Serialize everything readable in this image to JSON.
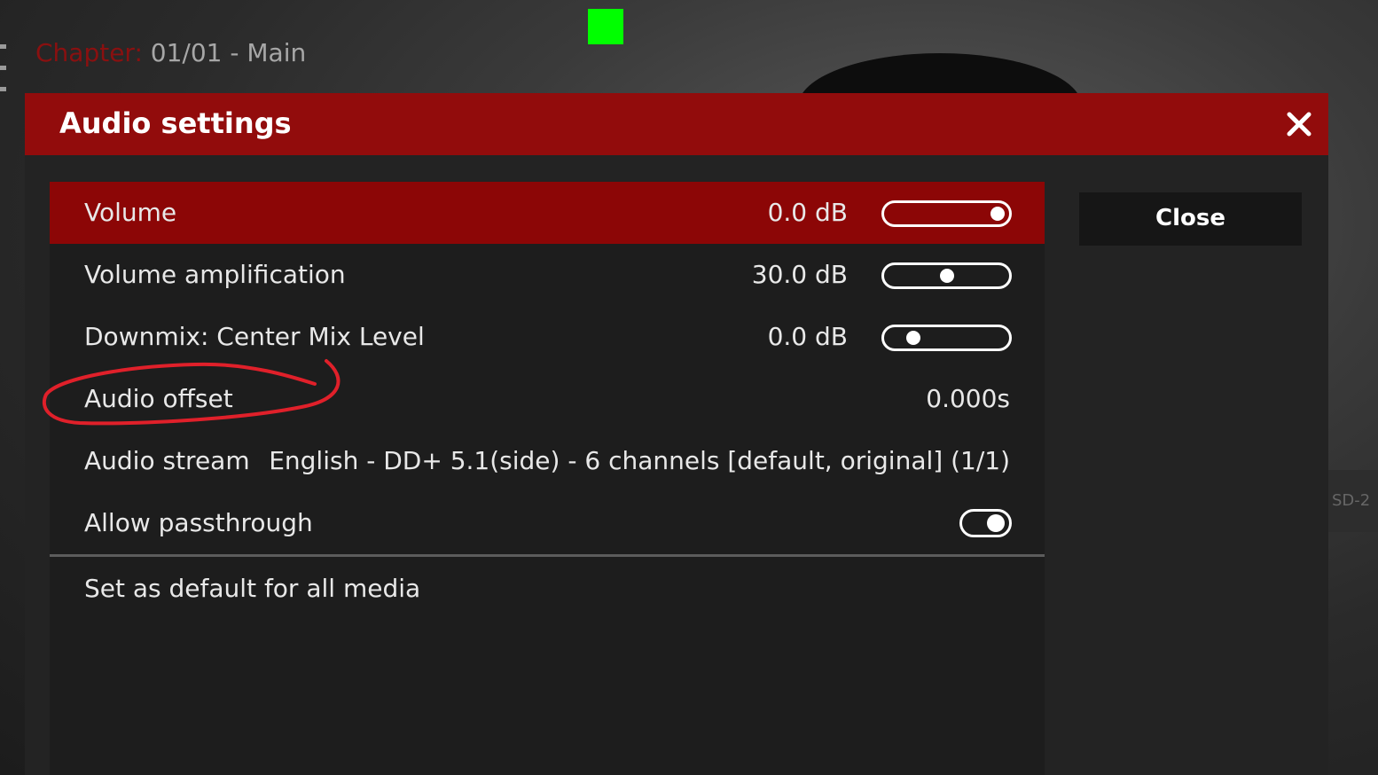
{
  "player": {
    "chapter_label": "Chapter:",
    "chapter_value": " 01/01 - Main",
    "side_panel_text": "SD-2"
  },
  "dialog": {
    "title": "Audio settings",
    "close_icon": "close-icon",
    "close_button_label": "Close",
    "settings": [
      {
        "label": "Volume",
        "value": "0.0 dB",
        "control": "slider",
        "level": 0.93,
        "selected": true
      },
      {
        "label": "Volume amplification",
        "value": "30.0 dB",
        "control": "slider",
        "level": 0.5,
        "selected": false
      },
      {
        "label": "Downmix: Center Mix Level",
        "value": "0.0 dB",
        "control": "slider",
        "level": 0.25,
        "selected": false
      },
      {
        "label": "Audio offset",
        "value": "0.000s",
        "control": "none",
        "selected": false
      },
      {
        "label": "Audio stream",
        "value": "English - DD+ 5.1(side) - 6 channels [default, original] (1/1)",
        "control": "none",
        "selected": false
      },
      {
        "label": "Allow passthrough",
        "value": "",
        "control": "toggle",
        "on": true,
        "selected": false
      }
    ],
    "set_default_label": "Set as default for all media"
  },
  "colors": {
    "header": "#920c0c",
    "selected_row": "#8c0606",
    "indicator": "#00ff00",
    "annotation": "#e0202a"
  }
}
